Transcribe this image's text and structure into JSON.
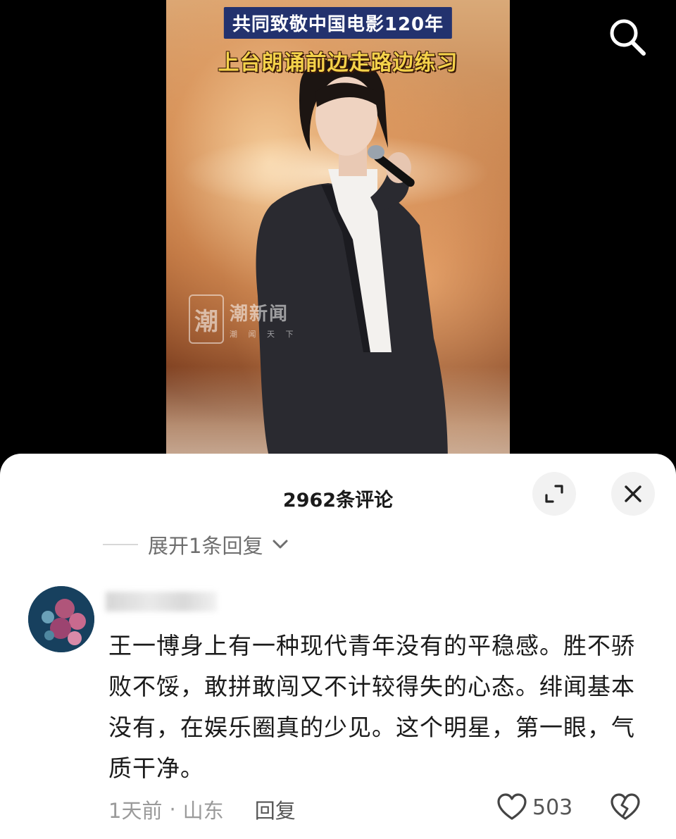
{
  "video": {
    "caption_line1": "共同致敬中国电影120年",
    "caption_line2": "上台朗诵前边走路边练习",
    "watermark_logo": "潮",
    "watermark_name": "潮新闻",
    "watermark_sub": "潮 闻 天 下",
    "colors": {
      "caption_bg": "#23326e",
      "caption_accent": "#f4d24a"
    }
  },
  "search": {
    "icon": "search-icon"
  },
  "comments_panel": {
    "title": "2962条评论",
    "expand_icon": "expand-icon",
    "close_icon": "close-icon",
    "collapsed_reply_label": "展开1条回复",
    "comment": {
      "text": "王一博身上有一种现代青年没有的平稳感。胜不骄败不馁，敢拼敢闯又不计较得失的心态。绯闻基本没有，在娱乐圈真的少见。这个明星，第一眼，气质干净。",
      "time": "1天前",
      "separator": "·",
      "location": "山东",
      "reply_label": "回复",
      "like_count": "503"
    }
  }
}
